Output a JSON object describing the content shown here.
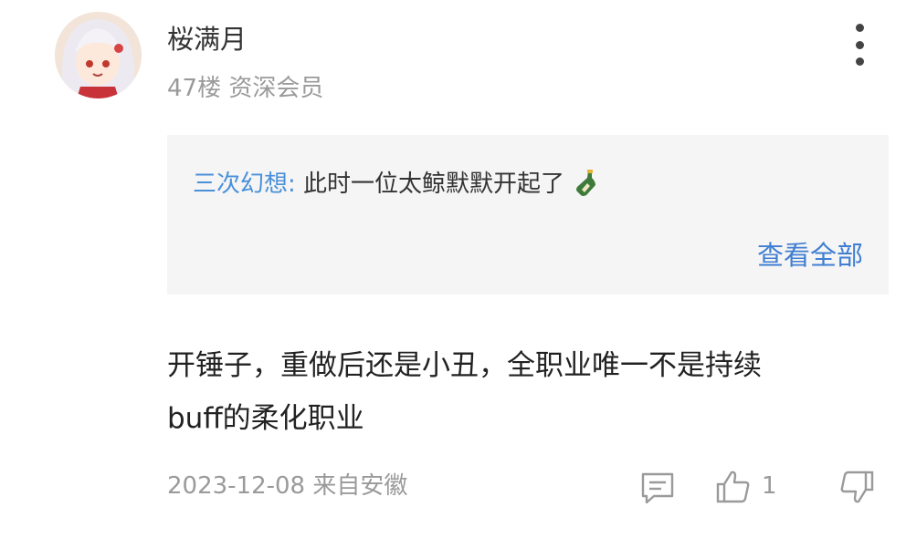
{
  "user": {
    "name": "桜满月",
    "meta": "47楼 资深会员"
  },
  "quote": {
    "author": "三次幻想:",
    "text": "此时一位太鲸默默开起了",
    "emoji": "bottle-icon",
    "view_all": "查看全部"
  },
  "content": {
    "line1": "开锤子，重做后还是小丑，全职业唯一不是持续",
    "line2": "buff的柔化职业"
  },
  "footer": {
    "timestamp": "2023-12-08 来自安徽",
    "like_count": "1"
  },
  "colors": {
    "link": "#3f7ed1",
    "quote_author": "#4a90d9",
    "quote_bg": "#f5f5f5",
    "meta": "#9a9a9a"
  }
}
